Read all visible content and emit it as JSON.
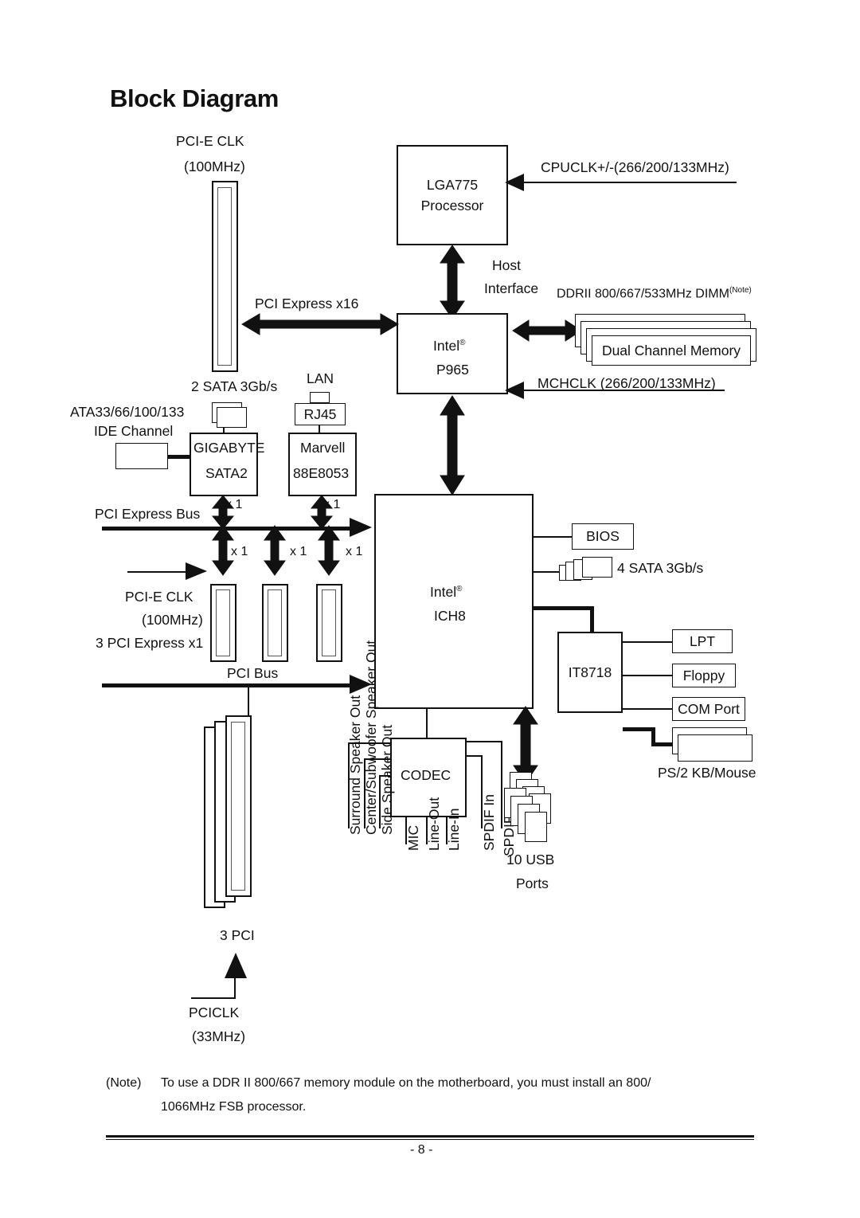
{
  "page": {
    "title": "Block Diagram",
    "page_number": "- 8 -",
    "note_marker": "(Note)",
    "note_text_line1": "To use a DDR II 800/667 memory module on the motherboard, you must install an 800/",
    "note_text_line2": "1066MHz FSB processor."
  },
  "chart_data": {
    "type": "diagram",
    "title": "Block Diagram",
    "nodes": [
      {
        "id": "cpu",
        "label": "LGA775 Processor"
      },
      {
        "id": "mch",
        "label": "Intel P965"
      },
      {
        "id": "ich",
        "label": "Intel ICH8"
      },
      {
        "id": "sata2",
        "label": "GIGABYTE SATA2"
      },
      {
        "id": "lan",
        "label": "Marvell 88E8053"
      },
      {
        "id": "sio",
        "label": "IT8718"
      },
      {
        "id": "codec",
        "label": "CODEC"
      },
      {
        "id": "bios",
        "label": "BIOS"
      },
      {
        "id": "memory",
        "label": "Dual Channel Memory"
      }
    ],
    "edges": [
      {
        "from": "cpu",
        "to": "mch",
        "label": "Host Interface"
      },
      {
        "from": "mch",
        "to": "memory",
        "label": "DDRII 800/667/533MHz DIMM"
      },
      {
        "from": "mch",
        "to": "pcie_x16_slot",
        "label": "PCI Express x16"
      },
      {
        "from": "mch",
        "to": "ich",
        "label": ""
      },
      {
        "from": "ich",
        "to": "bios",
        "label": ""
      },
      {
        "from": "ich",
        "to": "sio",
        "label": ""
      },
      {
        "from": "ich",
        "to": "codec",
        "label": ""
      },
      {
        "from": "ich",
        "to": "usb",
        "label": "10 USB Ports"
      }
    ]
  },
  "clocks": {
    "pcie_clk_top_line1": "PCI-E CLK",
    "pcie_clk_top_line2": "(100MHz)",
    "pcie_clk_mid_line1": "PCI-E CLK",
    "pcie_clk_mid_line2": "(100MHz)",
    "cpuclk": "CPUCLK+/-(266/200/133MHz)",
    "mchclk": "MCHCLK (266/200/133MHz)",
    "pciclk_line1": "PCICLK",
    "pciclk_line2": "(33MHz)"
  },
  "cpu": {
    "line1": "LGA775",
    "line2": "Processor"
  },
  "northbridge": {
    "line1": "Intel",
    "reg": "®",
    "line2": "P965"
  },
  "southbridge": {
    "line1": "Intel",
    "reg": "®",
    "line2": "ICH8"
  },
  "host_interface": {
    "line1": "Host",
    "line2": "Interface"
  },
  "memory": {
    "header": "DDRII 800/667/533MHz DIMM",
    "header_sup": "(Note)",
    "dimm_label": "Dual Channel Memory"
  },
  "pcie": {
    "x16_label": "PCI Express x16",
    "bus_label": "PCI Express Bus",
    "slot_count_label": "3 PCI Express x1",
    "lane_sata2": "x 1",
    "lane_lan": "x 1",
    "lane_slot1": "x 1",
    "lane_slot2": "x 1",
    "lane_slot3": "x 1"
  },
  "pci": {
    "bus_label": "PCI Bus",
    "slot_count_label": "3 PCI"
  },
  "storage": {
    "ide_line1": "ATA33/66/100/133",
    "ide_line2": "IDE Channel",
    "sata2_chip_line1": "GIGABYTE",
    "sata2_chip_line2": "SATA2",
    "sata2_ports_label": "2 SATA 3Gb/s",
    "ich_sata_label": "4 SATA 3Gb/s"
  },
  "network": {
    "lan_label": "LAN",
    "rj45_label": "RJ45",
    "chip_line1": "Marvell",
    "chip_line2": "88E8053"
  },
  "bios": {
    "label": "BIOS"
  },
  "superio": {
    "label": "IT8718",
    "lpt": "LPT",
    "floppy": "Floppy",
    "com": "COM Port",
    "ps2": "PS/2 KB/Mouse"
  },
  "audio": {
    "codec_label": "CODEC",
    "jacks": [
      "Surround Speaker Out",
      "Center/Subwoofer Speaker Out",
      "Side Speaker Out",
      "MIC",
      "Line-Out",
      "Line-In",
      "SPDIF In",
      "SPDIF Out"
    ]
  },
  "usb": {
    "line1": "10 USB",
    "line2": "Ports"
  },
  "colors": {
    "ink": "#111111",
    "grey_outline": "#555555",
    "background": "#ffffff"
  }
}
